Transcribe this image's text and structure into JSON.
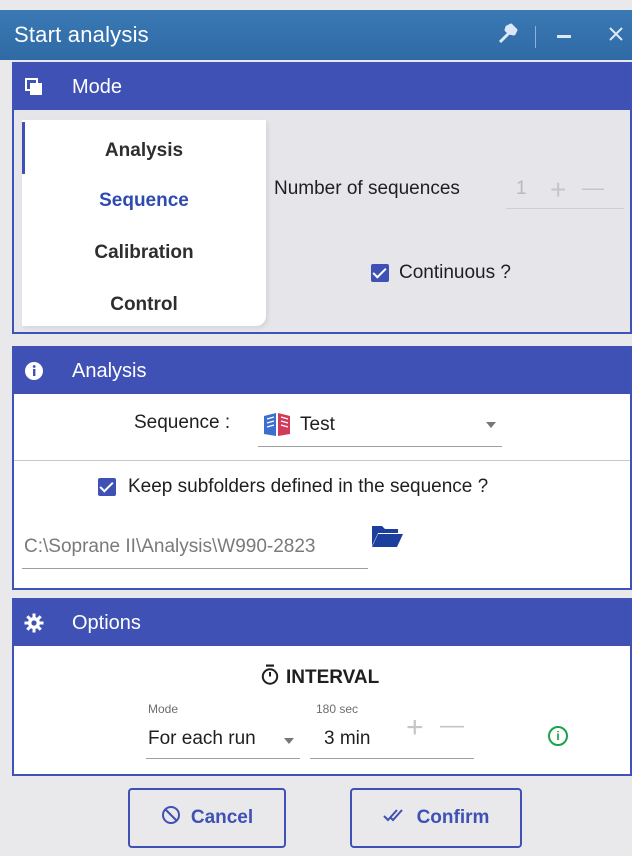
{
  "window": {
    "title": "Start analysis"
  },
  "mode_section": {
    "header": "Mode",
    "items": [
      {
        "label": "Analysis",
        "active": false
      },
      {
        "label": "Sequence",
        "active": true
      },
      {
        "label": "Calibration",
        "active": false
      },
      {
        "label": "Control",
        "active": false
      }
    ],
    "number_of_sequences_label": "Number of sequences",
    "number_of_sequences_value": "1",
    "plus": "+",
    "minus": "—",
    "continuous_label": "Continuous ?",
    "continuous_checked": true
  },
  "analysis_section": {
    "header": "Analysis",
    "sequence_label": "Sequence :",
    "sequence_value": "Test",
    "keep_subfolders_label": "Keep subfolders defined in the sequence ?",
    "keep_subfolders_checked": true,
    "path": "C:\\Soprane II\\Analysis\\W990-2823"
  },
  "options_section": {
    "header": "Options",
    "interval_label": "INTERVAL",
    "mode_field_label": "Mode",
    "mode_value": "For each run",
    "interval_hint": "180 sec",
    "interval_value": "3 min",
    "plus": "+",
    "minus": "—",
    "info": "i"
  },
  "buttons": {
    "cancel": "Cancel",
    "confirm": "Confirm"
  },
  "colors": {
    "accent": "#3f51b5",
    "title_bar": "#2f6aa5",
    "info_green": "#1aa34a"
  }
}
